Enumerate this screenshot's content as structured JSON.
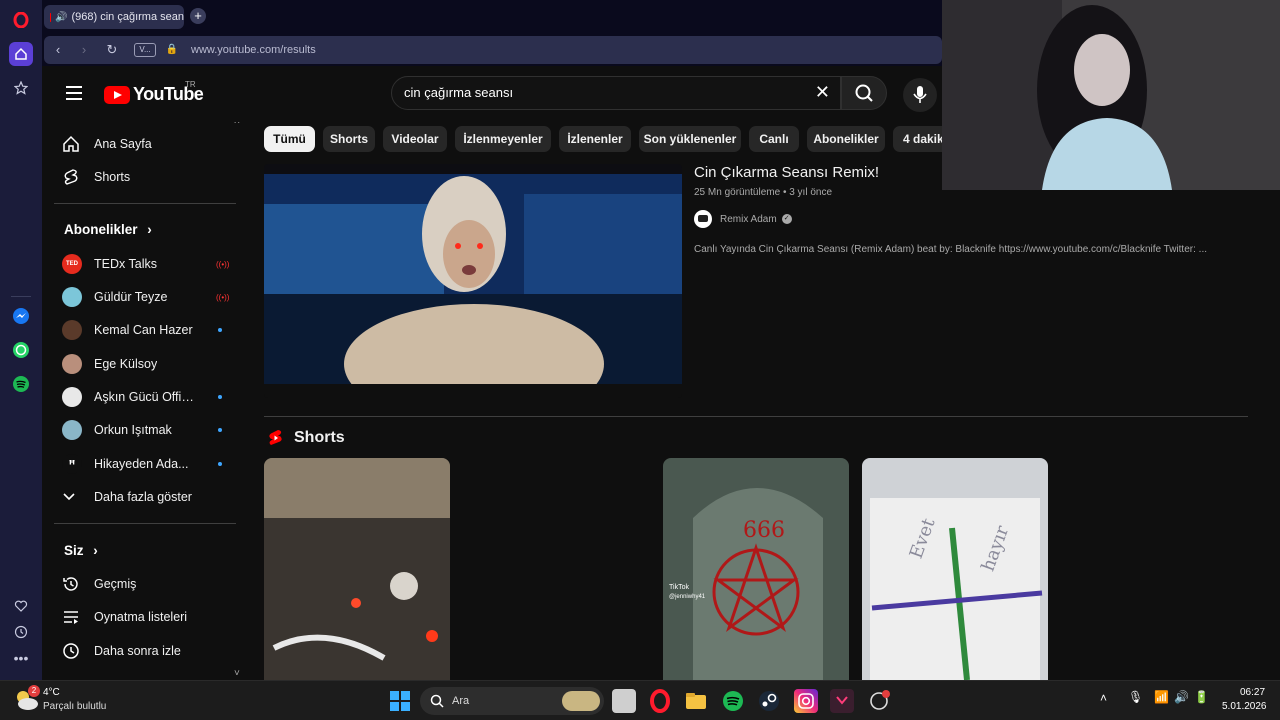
{
  "browser": {
    "tab_title": "(968) cin çağırma sean",
    "url": "www.youtube.com/results",
    "tab_btn_label": "V..."
  },
  "youtube": {
    "logo_text": "YouTube",
    "country": "TR",
    "search_value": "cin çağırma seansı",
    "sidebar": {
      "main": [
        {
          "label": "Ana Sayfa",
          "icon": "home-icon"
        },
        {
          "label": "Shorts",
          "icon": "shorts-icon"
        }
      ],
      "subs_title": "Abonelikler",
      "subs": [
        {
          "label": "TEDx Talks",
          "status": "live"
        },
        {
          "label": "Güldür Teyze",
          "status": "live"
        },
        {
          "label": "Kemal Can Hazer",
          "status": "new"
        },
        {
          "label": "Ege Külsoy",
          "status": ""
        },
        {
          "label": "Aşkın Gücü Offic...",
          "status": "new"
        },
        {
          "label": "Orkun Işıtmak",
          "status": "new"
        },
        {
          "label": "Hikayeden Ada...",
          "status": "new"
        }
      ],
      "show_more": "Daha fazla göster",
      "you_title": "Siz",
      "you": [
        {
          "label": "Geçmiş",
          "icon": "history-icon"
        },
        {
          "label": "Oynatma listeleri",
          "icon": "playlist-icon"
        },
        {
          "label": "Daha sonra izle",
          "icon": "watch-later-icon"
        }
      ]
    },
    "chips": [
      "Tümü",
      "Shorts",
      "Videolar",
      "İzlenmeyenler",
      "İzlenenler",
      "Son yüklenenler",
      "Canlı",
      "Abonelikler",
      "4 dakik"
    ],
    "video": {
      "title": "Cin Çıkarma Seansı Remix!",
      "meta": "25 Mn görüntüleme • 3 yıl önce",
      "channel": "Remix Adam",
      "description": "Canlı Yayında Cin Çıkarma Seansı (Remix Adam) beat by: Blacknife https://www.youtube.com/c/Blacknife Twitter: ..."
    },
    "shorts_title": "Shorts",
    "short_overlay": {
      "tiktok": "TikTok",
      "handle": "@jenniwhy41",
      "sign": "666",
      "yes": "Evet",
      "no": "hayır"
    }
  },
  "taskbar": {
    "temp": "4°C",
    "weather": "Parçalı bulutlu",
    "weather_badge": "2",
    "search": "Ara",
    "time": "06:27",
    "date": "5.01.2026"
  },
  "colors": {
    "accent": "#ff0000",
    "link": "#3ea6ff"
  }
}
